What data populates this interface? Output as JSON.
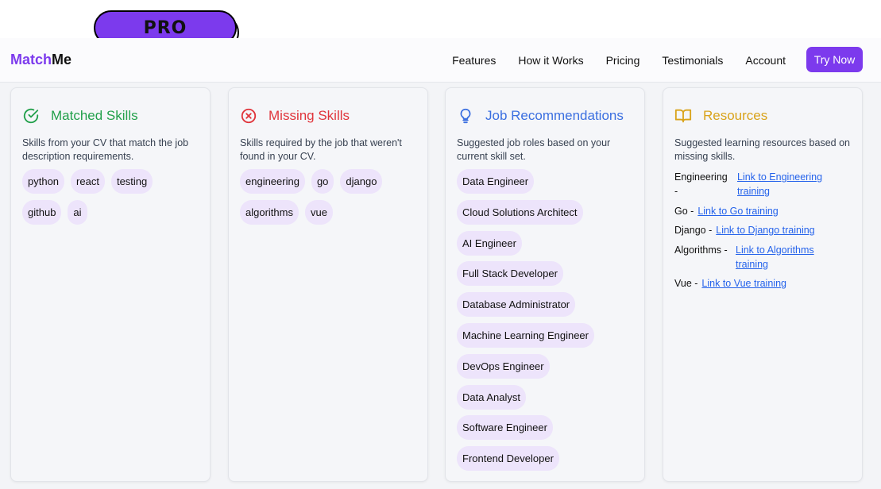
{
  "badge": {
    "label": "PRO"
  },
  "brand": {
    "part1": "Match",
    "part2": "Me"
  },
  "nav": {
    "links": [
      "Features",
      "How it Works",
      "Pricing",
      "Testimonials",
      "Account"
    ],
    "cta": "Try Now"
  },
  "matched": {
    "title": "Matched Skills",
    "description": "Skills from your CV that match the job description requirements.",
    "skills": [
      "python",
      "react",
      "testing",
      "github",
      "ai"
    ],
    "color": "#22a04b",
    "icon": "check-circle-icon"
  },
  "missing": {
    "title": "Missing Skills",
    "description": "Skills required by the job that weren't found in your CV.",
    "skills": [
      "engineering",
      "go",
      "django",
      "algorithms",
      "vue"
    ],
    "color": "#e0343b",
    "icon": "x-circle-icon"
  },
  "jobs": {
    "title": "Job Recommendations",
    "description": "Suggested job roles based on your current skill set.",
    "roles": [
      "Data Engineer",
      "Cloud Solutions Architect",
      "AI Engineer",
      "Full Stack Developer",
      "Database Administrator",
      "Machine Learning Engineer",
      "DevOps Engineer",
      "Data Analyst",
      "Software Engineer",
      "Frontend Developer"
    ],
    "color": "#3b6fe0",
    "icon": "lightbulb-icon"
  },
  "resources": {
    "title": "Resources",
    "description": "Suggested learning resources based on missing skills.",
    "items": [
      {
        "name": "Engineering -",
        "link": "Link to Engineering training"
      },
      {
        "name": "Go -",
        "link": "Link to Go training"
      },
      {
        "name": "Django -",
        "link": "Link to Django training"
      },
      {
        "name": "Algorithms -",
        "link": "Link to Algorithms training"
      },
      {
        "name": "Vue -",
        "link": "Link to Vue training"
      }
    ],
    "color": "#d9a31b",
    "icon": "book-icon"
  }
}
